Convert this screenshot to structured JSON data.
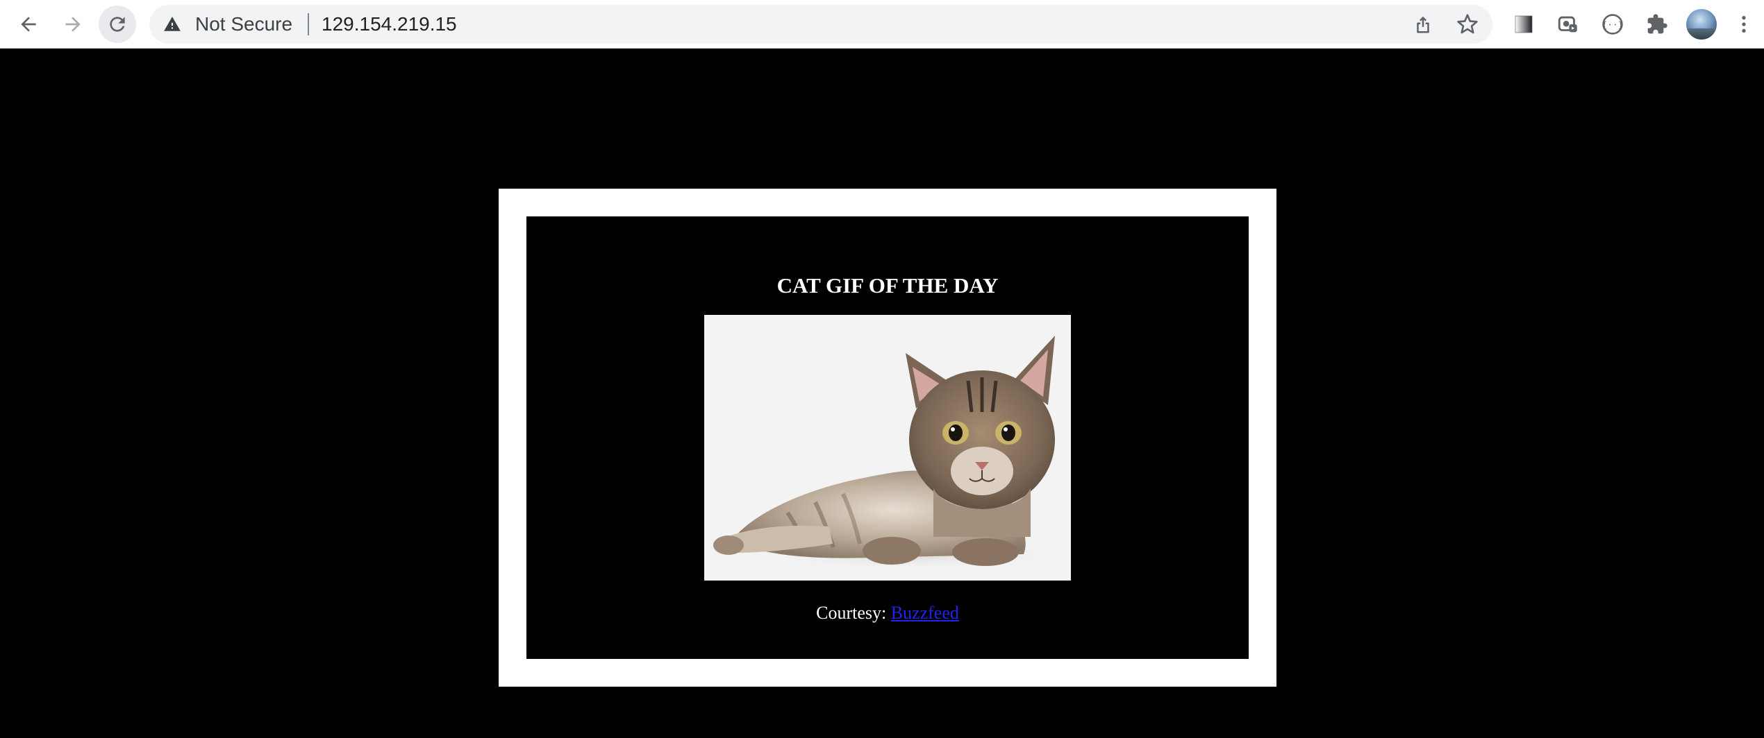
{
  "browser": {
    "security_label": "Not Secure",
    "url": "129.154.219.15",
    "icons": {
      "back": "arrow-left-icon",
      "forward": "arrow-right-icon",
      "reload": "reload-icon",
      "warning": "warning-triangle-icon",
      "share": "share-icon",
      "bookmark": "star-icon",
      "extension1": "gradient-square-icon",
      "extension2": "screenshot-extension-icon",
      "extension3": "code-braces-icon",
      "extensions": "puzzle-icon",
      "profile": "avatar",
      "menu": "kebab-menu-icon"
    }
  },
  "page": {
    "heading": "CAT GIF OF THE DAY",
    "image_subject": "tabby kitten lying down",
    "courtesy_label": "Courtesy: ",
    "courtesy_link": "Buzzfeed",
    "colors": {
      "background": "#000000",
      "frame": "#ffffff",
      "text": "#ffffff",
      "link": "#2222ee"
    }
  }
}
